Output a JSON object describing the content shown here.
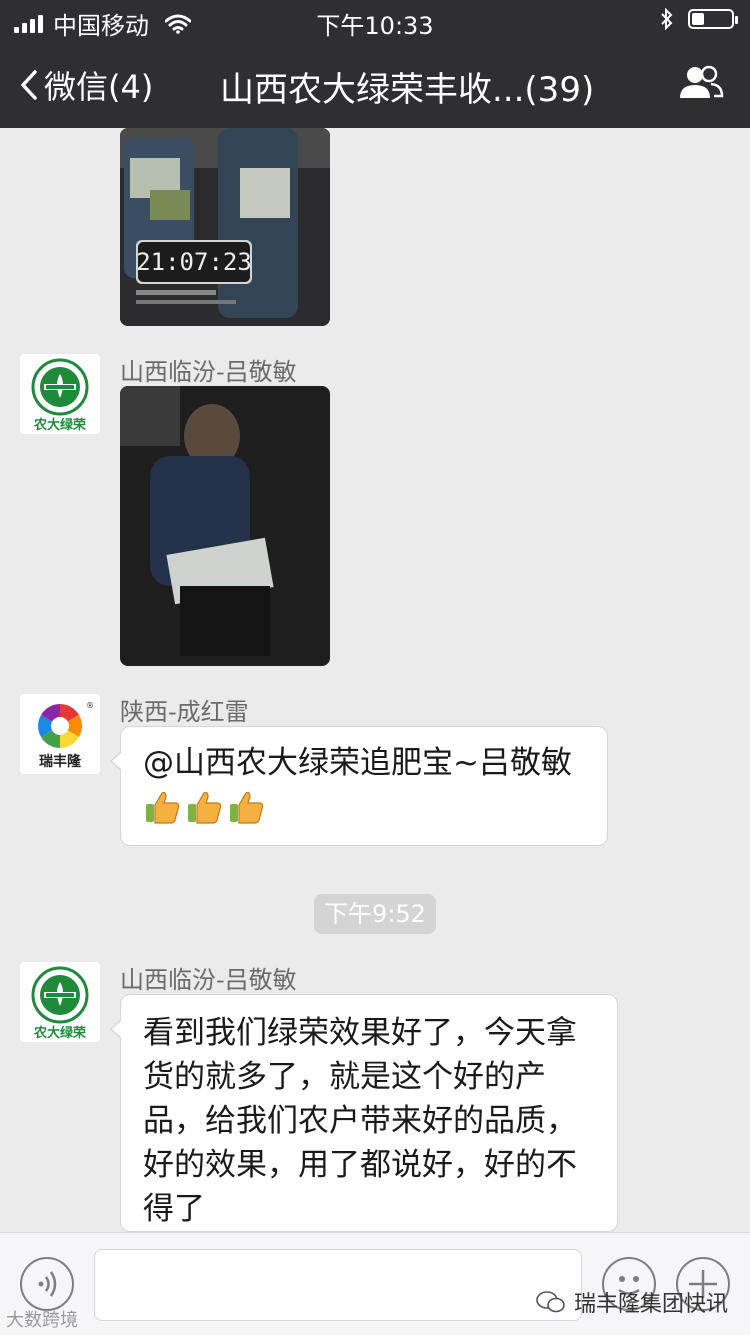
{
  "status_bar": {
    "carrier": "中国移动",
    "time": "下午10:33"
  },
  "nav": {
    "back_label": "微信(4)",
    "title": "山西农大绿荣丰收...(39)"
  },
  "messages": [
    {
      "type": "image",
      "description_icon": "video-frame-photo",
      "overlay_timestamp": "21:07:23"
    },
    {
      "type": "image",
      "sender": "山西临汾-吕敬敏",
      "avatar_logo_text": "农大绿荣",
      "avatar_logo_mark": "LURONG"
    },
    {
      "type": "text",
      "sender": "陕西-成红雷",
      "avatar_logo_text": "瑞丰隆",
      "text": "@山西农大绿荣追肥宝~吕敬敏",
      "emojis": [
        "thumbs-up",
        "thumbs-up",
        "thumbs-up"
      ]
    },
    {
      "type": "time",
      "text": "下午9:52"
    },
    {
      "type": "text",
      "sender": "山西临汾-吕敬敏",
      "avatar_logo_text": "农大绿荣",
      "avatar_logo_mark": "LURONG",
      "lines": [
        "看到我们绿荣效果好了，今天拿",
        "货的就多了，就是这个好的产",
        "品，给我们农户带来好的品质，",
        "好的效果，用了都说好，好的不",
        "得了"
      ]
    }
  ],
  "watermarks": {
    "right": "瑞丰隆集团快讯",
    "left": "大数跨境"
  },
  "colors": {
    "nav_bg": "#2f2f33",
    "chat_bg": "#ebebeb",
    "bubble_bg": "#ffffff",
    "logo_green": "#1f8a3a"
  }
}
